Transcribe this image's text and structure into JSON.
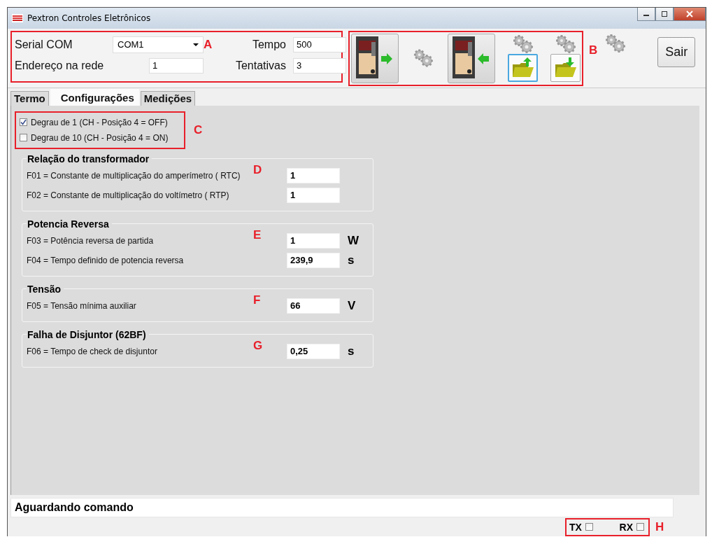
{
  "window": {
    "title": "Pextron Controles Eletrônicos"
  },
  "connection": {
    "annotation": "A",
    "serial_label": "Serial COM",
    "serial_value": "COM1",
    "address_label": "Endereço na rede",
    "address_value": "1",
    "time_label": "Tempo",
    "time_value": "500",
    "retries_label": "Tentativas",
    "retries_value": "3"
  },
  "toolbar": {
    "annotation": "B"
  },
  "exit_button": "Sair",
  "tabs": [
    {
      "label": "Termo",
      "selected": false
    },
    {
      "label": "Configurações",
      "selected": true
    },
    {
      "label": "Medições",
      "selected": false
    }
  ],
  "step_options": {
    "annotation": "C",
    "items": [
      {
        "label": "Degrau de 1 (CH - Posição 4 = OFF)",
        "checked": true
      },
      {
        "label": "Degrau de 10 (CH - Posição 4 = ON)",
        "checked": false
      }
    ]
  },
  "groups": [
    {
      "title": "Relação do transformador",
      "annotation": "D",
      "params": [
        {
          "label": "F01 = Constante de multiplicação do amperímetro ( RTC)",
          "value": "1"
        },
        {
          "label": "F02 = Constante de multiplicação do voltímetro ( RTP)",
          "value": "1"
        }
      ]
    },
    {
      "title": "Potencia Reversa",
      "annotation": "E",
      "params": [
        {
          "label": "F03 = Potência reversa de partida",
          "value": "1",
          "unit": "W"
        },
        {
          "label": "F04 = Tempo definido de potencia reversa",
          "value": "239,9",
          "unit": "s"
        }
      ]
    },
    {
      "title": "Tensão",
      "annotation": "F",
      "params": [
        {
          "label": "F05 = Tensão mínima auxiliar",
          "value": "66",
          "unit": "V"
        }
      ]
    },
    {
      "title": "Falha de Disjuntor (62BF)",
      "annotation": "G",
      "params": [
        {
          "label": "F06 =  Tempo de check de disjuntor",
          "value": "0,25",
          "unit": "s"
        }
      ]
    }
  ],
  "status": {
    "message": "Aguardando comando",
    "annotation": "H",
    "indicators": [
      {
        "label": "TX",
        "checked": false
      },
      {
        "label": "RX",
        "checked": false
      }
    ]
  }
}
